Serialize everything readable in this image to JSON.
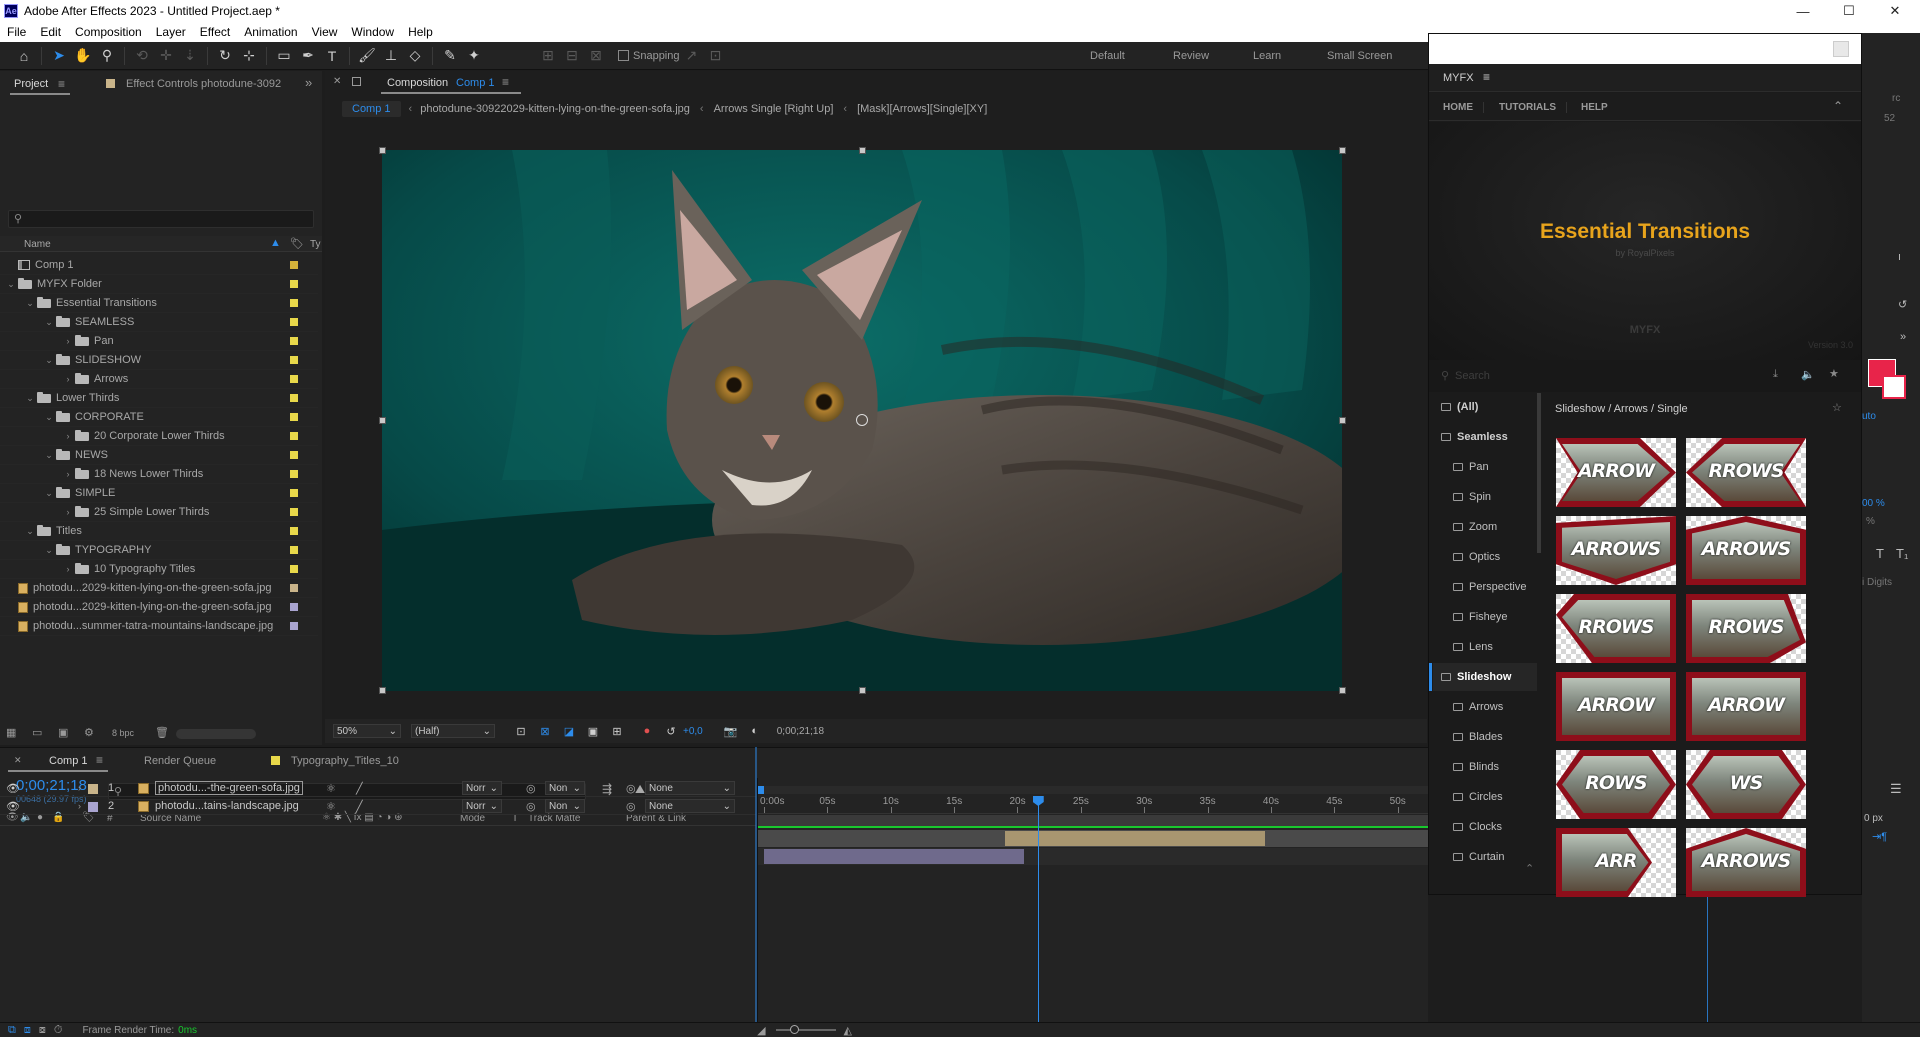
{
  "app": {
    "title": "Adobe After Effects 2023 - Untitled Project.aep *",
    "badge": "Ae"
  },
  "window_controls": {
    "minimize": "—",
    "maximize": "☐",
    "close": "✕"
  },
  "menu": [
    "File",
    "Edit",
    "Composition",
    "Layer",
    "Effect",
    "Animation",
    "View",
    "Window",
    "Help"
  ],
  "toolbar": {
    "snapping_label": "Snapping"
  },
  "workspaces": [
    "Default",
    "Review",
    "Learn",
    "Small Screen"
  ],
  "project": {
    "tab_label": "Project",
    "effect_controls_label": "Effect Controls photodune-3092",
    "name_header": "Name",
    "type_header": "Ty",
    "bpc": "8 bpc",
    "items": [
      {
        "label": "Comp 1",
        "level": 0,
        "twirl": "",
        "kind": "comp",
        "color": "#d4b23a"
      },
      {
        "label": "MYFX Folder",
        "level": 0,
        "twirl": "v",
        "kind": "folder",
        "color": "#e8d84a"
      },
      {
        "label": "Essential Transitions",
        "level": 1,
        "twirl": "v",
        "kind": "folder",
        "color": "#e8d84a"
      },
      {
        "label": "SEAMLESS",
        "level": 2,
        "twirl": "v",
        "kind": "folder",
        "color": "#e8d84a"
      },
      {
        "label": "Pan",
        "level": 3,
        "twirl": ">",
        "kind": "folder",
        "color": "#e8d84a"
      },
      {
        "label": "SLIDESHOW",
        "level": 2,
        "twirl": "v",
        "kind": "folder",
        "color": "#e8d84a"
      },
      {
        "label": "Arrows",
        "level": 3,
        "twirl": ">",
        "kind": "folder",
        "color": "#e8d84a"
      },
      {
        "label": "Lower Thirds",
        "level": 1,
        "twirl": "v",
        "kind": "folder",
        "color": "#e8d84a"
      },
      {
        "label": "CORPORATE",
        "level": 2,
        "twirl": "v",
        "kind": "folder",
        "color": "#e8d84a"
      },
      {
        "label": "20 Corporate Lower Thirds",
        "level": 3,
        "twirl": ">",
        "kind": "folder",
        "color": "#e8d84a"
      },
      {
        "label": "NEWS",
        "level": 2,
        "twirl": "v",
        "kind": "folder",
        "color": "#e8d84a"
      },
      {
        "label": "18 News Lower Thirds",
        "level": 3,
        "twirl": ">",
        "kind": "folder",
        "color": "#e8d84a"
      },
      {
        "label": "SIMPLE",
        "level": 2,
        "twirl": "v",
        "kind": "folder",
        "color": "#e8d84a"
      },
      {
        "label": "25 Simple Lower Thirds",
        "level": 3,
        "twirl": ">",
        "kind": "folder",
        "color": "#e8d84a"
      },
      {
        "label": "Titles",
        "level": 1,
        "twirl": "v",
        "kind": "folder",
        "color": "#e8d84a"
      },
      {
        "label": "TYPOGRAPHY",
        "level": 2,
        "twirl": "v",
        "kind": "folder",
        "color": "#e8d84a"
      },
      {
        "label": "10 Typography Titles",
        "level": 3,
        "twirl": ">",
        "kind": "folder",
        "color": "#e8d84a"
      },
      {
        "label": "photodu...2029-kitten-lying-on-the-green-sofa.jpg",
        "level": 0,
        "twirl": "",
        "kind": "image",
        "color": "#c9b48a"
      },
      {
        "label": "photodu...2029-kitten-lying-on-the-green-sofa.jpg",
        "level": 0,
        "twirl": "",
        "kind": "image",
        "color": "#a9a4d0"
      },
      {
        "label": "photodu...summer-tatra-mountains-landscape.jpg",
        "level": 0,
        "twirl": "",
        "kind": "image",
        "color": "#a9a4d0"
      }
    ]
  },
  "composition": {
    "tab_prefix": "Composition",
    "tab_name": "Comp 1",
    "breadcrumbs": [
      "Comp 1",
      "photodune-30922029-kitten-lying-on-the-green-sofa.jpg",
      "Arrows Single [Right Up]",
      "[Mask][Arrows][Single][XY]"
    ],
    "zoom": "50%",
    "resolution": "(Half)",
    "exposure": "+0,0",
    "timecode": "0;00;21;18"
  },
  "timeline": {
    "tabs": [
      "Comp 1",
      "Render Queue",
      "Typography_Titles_10"
    ],
    "current_time": "0;00;21;18",
    "frame_info": "00648 (29.97 fps)",
    "columns": {
      "num": "#",
      "source": "Source Name",
      "mode": "Mode",
      "t": "T",
      "track_matte": "Track Matte",
      "parent": "Parent & Link"
    },
    "ruler": [
      "0:00s",
      "05s",
      "10s",
      "15s",
      "20s",
      "25s",
      "30s",
      "35s",
      "40s",
      "45s",
      "50s"
    ],
    "playhead_seconds": 21.6,
    "ruler_max_seconds": 52,
    "layers": [
      {
        "num": "1",
        "name": "photodu...-the-green-sofa.jpg",
        "mode": "Norr",
        "matte": "Non",
        "parent": "None",
        "label_color": "#c9b48a",
        "bar_start": 19,
        "bar_end": 39.5,
        "bar_color": "#a89670"
      },
      {
        "num": "2",
        "name": "photodu...tains-landscape.jpg",
        "mode": "Norr",
        "matte": "Non",
        "parent": "None",
        "label_color": "#a9a4d0",
        "bar_start": 0,
        "bar_end": 20.5,
        "bar_color": "#6f6a8c"
      }
    ]
  },
  "myfx": {
    "title": "MYFX",
    "nav": [
      "HOME",
      "TUTORIALS",
      "HELP"
    ],
    "banner_title": "Essential Transitions",
    "banner_sub": "by RoyalPixels",
    "banner_logo": "MYFX",
    "banner_version": "Version 3.0",
    "search_placeholder": "Search",
    "breadcrumb": "Slideshow / Arrows / Single",
    "categories": [
      {
        "label": "(All)",
        "type": "top",
        "selected": false
      },
      {
        "label": "Seamless",
        "type": "top",
        "selected": false
      },
      {
        "label": "Pan",
        "type": "sub",
        "selected": false
      },
      {
        "label": "Spin",
        "type": "sub",
        "selected": false
      },
      {
        "label": "Zoom",
        "type": "sub",
        "selected": false
      },
      {
        "label": "Optics",
        "type": "sub",
        "selected": false
      },
      {
        "label": "Perspective",
        "type": "sub",
        "selected": false
      },
      {
        "label": "Fisheye",
        "type": "sub",
        "selected": false
      },
      {
        "label": "Lens",
        "type": "sub",
        "selected": false
      },
      {
        "label": "Slideshow",
        "type": "top",
        "selected": true
      },
      {
        "label": "Arrows",
        "type": "sub",
        "selected": false
      },
      {
        "label": "Blades",
        "type": "sub",
        "selected": false
      },
      {
        "label": "Blinds",
        "type": "sub",
        "selected": false
      },
      {
        "label": "Circles",
        "type": "sub",
        "selected": false
      },
      {
        "label": "Clocks",
        "type": "sub",
        "selected": false
      },
      {
        "label": "Curtain",
        "type": "sub",
        "selected": false
      }
    ],
    "thumbs": [
      "ARROW",
      "RROWS",
      "ARROWS",
      "ARROWS",
      "RROWS",
      "RROWS",
      "ARROW",
      "ARROW",
      "ROWS",
      "WS",
      "ARR",
      "ARROWS"
    ]
  },
  "right_panel": {
    "percent": "00 %",
    "percent2": "%",
    "auto": "uto",
    "px": "0 px",
    "digits": "i Digits",
    "t1": "T",
    "t2": "T₁"
  },
  "status": {
    "frame_render_label": "Frame Render Time:",
    "frame_render_value": "0ms"
  },
  "colors": {
    "accent": "#2d8ceb",
    "green_line": "#19c82e",
    "myfx_gold": "#e8a41c",
    "thumb_red": "#8e0e1a",
    "swatch": "#e8244a"
  }
}
